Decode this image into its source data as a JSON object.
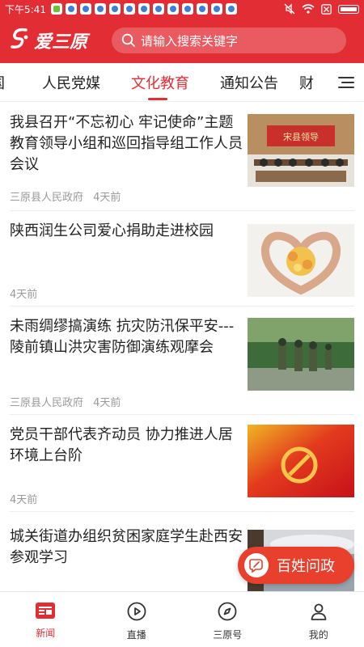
{
  "status_bar": {
    "time": "下午5:41"
  },
  "header": {
    "logo_text": "爱三原",
    "search_placeholder": "请输入搜索关键字"
  },
  "tabs": [
    {
      "label": "国"
    },
    {
      "label": "人民党媒"
    },
    {
      "label": "文化教育",
      "active": true
    },
    {
      "label": "通知公告"
    },
    {
      "label": "财"
    }
  ],
  "articles": [
    {
      "title": "我县召开“不忘初心 牢记使命”主题教育领导小组和巡回指导组工作人员会议",
      "source": "三原县人民政府",
      "time": "4天前",
      "thumb_caption": "宋县领导"
    },
    {
      "title": "陕西润生公司爱心捐助走进校园",
      "source": "",
      "time": "4天前",
      "thumb_caption": ""
    },
    {
      "title": "未雨绸缪搞演练 抗灾防汛保平安---陵前镇山洪灾害防御演练观摩会",
      "source": "三原县人民政府",
      "time": "4天前",
      "thumb_caption": ""
    },
    {
      "title": "党员干部代表齐动员 协力推进人居环境上台阶",
      "source": "",
      "time": "4天前",
      "thumb_caption": ""
    },
    {
      "title": "城关街道办组织贫困家庭学生赴西安参观学习",
      "source": "",
      "time": "",
      "thumb_caption": ""
    }
  ],
  "fab": {
    "label": "百姓问政"
  },
  "bottom_nav": [
    {
      "label": "新闻",
      "icon": "news-icon",
      "active": true
    },
    {
      "label": "直播",
      "icon": "play-icon"
    },
    {
      "label": "三原号",
      "icon": "compass-icon"
    },
    {
      "label": "我的",
      "icon": "person-icon"
    }
  ],
  "colors": {
    "brand_red": "#e32d35",
    "fab_red": "#e8402c"
  }
}
